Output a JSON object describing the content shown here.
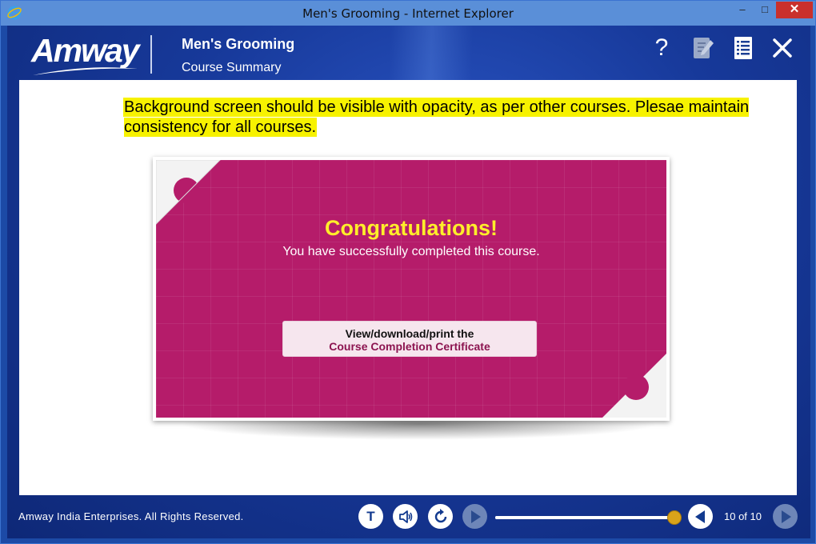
{
  "window": {
    "title": "Men's Grooming - Internet Explorer",
    "minimize": "–",
    "maximize": "□",
    "close": "✕"
  },
  "header": {
    "logo_text": "Amway",
    "course_title": "Men's Grooming",
    "course_subtitle": "Course Summary",
    "help_label": "?"
  },
  "content": {
    "review_note": "Background screen should be visible with opacity, as per other courses. Plesae maintain consistency for all courses.",
    "congrats_title": "Congratulations!",
    "congrats_message": "You have successfully completed this course.",
    "certificate_button": {
      "line1": "View/download/print the",
      "line2": "Course Completion Certificate"
    }
  },
  "footer": {
    "copyright": "Amway India Enterprises. All Rights Reserved.",
    "transcript_label": "T",
    "progress": 1.0,
    "page_counter": "10 of 10"
  },
  "colors": {
    "accent_magenta": "#b51c6a",
    "congrats_yellow": "#ffee2a",
    "note_highlight": "#f7f200",
    "progress_thumb": "#d9a31a",
    "background_blue": "#17399a"
  },
  "icons": {
    "browser": "ie-icon",
    "help": "help-icon",
    "notes": "notes-icon",
    "menu": "menu-list-icon",
    "close": "close-icon",
    "audio": "speaker-icon",
    "replay": "replay-icon",
    "play": "play-icon",
    "prev": "previous-icon",
    "next": "next-icon"
  }
}
